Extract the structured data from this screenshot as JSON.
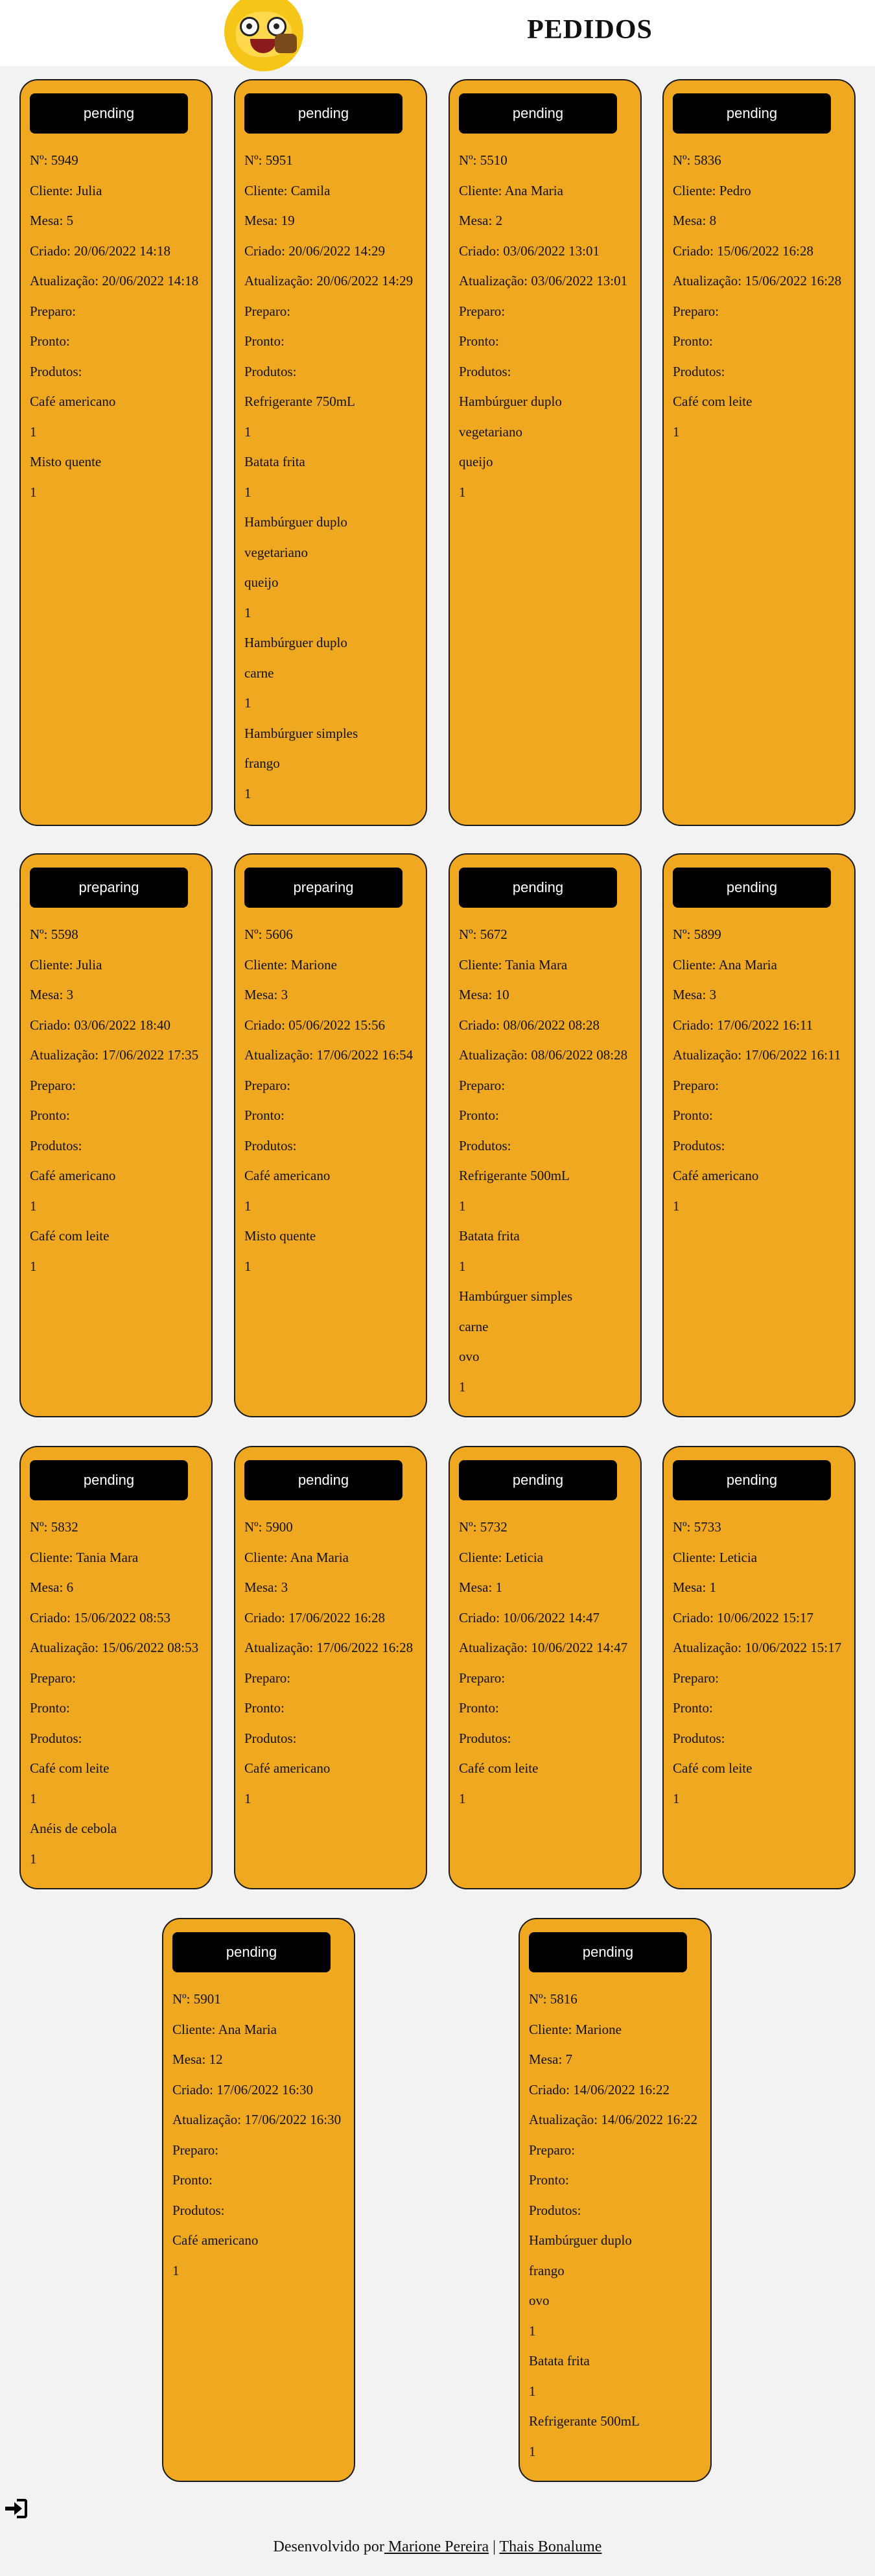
{
  "header": {
    "title": "PEDIDOS",
    "logo": "character-eating-burger-logo"
  },
  "labels": {
    "number": "Nº: ",
    "client": "Cliente: ",
    "table": "Mesa: ",
    "created": "Criado: ",
    "updated": "Atualização: ",
    "preparing": "Preparo:",
    "ready": "Pronto:",
    "products": "Produtos:"
  },
  "orders": [
    {
      "status": "pending",
      "number": "5949",
      "client": "Julia",
      "table": "5",
      "created": "20/06/2022 14:18",
      "updated": "20/06/2022 14:18",
      "products": [
        {
          "name": [
            "Café americano"
          ],
          "qty": "1"
        },
        {
          "name": [
            "Misto quente"
          ],
          "qty": "1"
        }
      ]
    },
    {
      "status": "pending",
      "number": "5951",
      "client": "Camila",
      "table": "19",
      "created": "20/06/2022 14:29",
      "updated": "20/06/2022 14:29",
      "products": [
        {
          "name": [
            "Refrigerante 750mL"
          ],
          "qty": "1"
        },
        {
          "name": [
            "Batata frita"
          ],
          "qty": "1"
        },
        {
          "name": [
            "Hambúrguer duplo",
            "vegetariano",
            "queijo"
          ],
          "qty": "1"
        },
        {
          "name": [
            "Hambúrguer duplo",
            "carne"
          ],
          "qty": "1"
        },
        {
          "name": [
            "Hambúrguer simples",
            "frango"
          ],
          "qty": "1"
        }
      ]
    },
    {
      "status": "pending",
      "number": "5510",
      "client": "Ana Maria",
      "table": "2",
      "created": "03/06/2022 13:01",
      "updated": "03/06/2022 13:01",
      "products": [
        {
          "name": [
            "Hambúrguer duplo",
            "vegetariano",
            "queijo"
          ],
          "qty": "1"
        }
      ]
    },
    {
      "status": "pending",
      "number": "5836",
      "client": "Pedro",
      "table": "8",
      "created": "15/06/2022 16:28",
      "updated": "15/06/2022 16:28",
      "products": [
        {
          "name": [
            "Café com leite"
          ],
          "qty": "1"
        }
      ]
    },
    {
      "status": "preparing",
      "number": "5598",
      "client": "Julia",
      "table": "3",
      "created": "03/06/2022 18:40",
      "updated": "17/06/2022 17:35",
      "products": [
        {
          "name": [
            "Café americano"
          ],
          "qty": "1"
        },
        {
          "name": [
            "Café com leite"
          ],
          "qty": "1"
        }
      ]
    },
    {
      "status": "preparing",
      "number": "5606",
      "client": "Marione",
      "table": "3",
      "created": "05/06/2022 15:56",
      "updated": "17/06/2022 16:54",
      "products": [
        {
          "name": [
            "Café americano"
          ],
          "qty": "1"
        },
        {
          "name": [
            "Misto quente"
          ],
          "qty": "1"
        }
      ]
    },
    {
      "status": "pending",
      "number": "5672",
      "client": "Tania Mara",
      "table": "10",
      "created": "08/06/2022 08:28",
      "updated": "08/06/2022 08:28",
      "products": [
        {
          "name": [
            "Refrigerante 500mL"
          ],
          "qty": "1"
        },
        {
          "name": [
            "Batata frita"
          ],
          "qty": "1"
        },
        {
          "name": [
            "Hambúrguer simples",
            "carne",
            "ovo"
          ],
          "qty": "1"
        }
      ]
    },
    {
      "status": "pending",
      "number": "5899",
      "client": "Ana Maria",
      "table": "3",
      "created": "17/06/2022 16:11",
      "updated": "17/06/2022 16:11",
      "products": [
        {
          "name": [
            "Café americano"
          ],
          "qty": "1"
        }
      ]
    },
    {
      "status": "pending",
      "number": "5832",
      "client": "Tania Mara",
      "table": "6",
      "created": "15/06/2022 08:53",
      "updated": "15/06/2022 08:53",
      "products": [
        {
          "name": [
            "Café com leite"
          ],
          "qty": "1"
        },
        {
          "name": [
            "Anéis de cebola"
          ],
          "qty": "1"
        }
      ]
    },
    {
      "status": "pending",
      "number": "5900",
      "client": "Ana Maria",
      "table": "3",
      "created": "17/06/2022 16:28",
      "updated": "17/06/2022 16:28",
      "products": [
        {
          "name": [
            "Café americano"
          ],
          "qty": "1"
        }
      ]
    },
    {
      "status": "pending",
      "number": "5732",
      "client": "Leticia",
      "table": "1",
      "created": "10/06/2022 14:47",
      "updated": "10/06/2022 14:47",
      "products": [
        {
          "name": [
            "Café com leite"
          ],
          "qty": "1"
        }
      ]
    },
    {
      "status": "pending",
      "number": "5733",
      "client": "Leticia",
      "table": "1",
      "created": "10/06/2022 15:17",
      "updated": "10/06/2022 15:17",
      "products": [
        {
          "name": [
            "Café com leite"
          ],
          "qty": "1"
        }
      ]
    },
    {
      "status": "pending",
      "number": "5901",
      "client": "Ana Maria",
      "table": "12",
      "created": "17/06/2022 16:30",
      "updated": "17/06/2022 16:30",
      "products": [
        {
          "name": [
            "Café americano"
          ],
          "qty": "1"
        }
      ]
    },
    {
      "status": "pending",
      "number": "5816",
      "client": "Marione",
      "table": "7",
      "created": "14/06/2022 16:22",
      "updated": "14/06/2022 16:22",
      "products": [
        {
          "name": [
            "Hambúrguer duplo",
            "frango",
            "ovo"
          ],
          "qty": "1"
        },
        {
          "name": [
            "Batata frita"
          ],
          "qty": "1"
        },
        {
          "name": [
            "Refrigerante 500mL"
          ],
          "qty": "1"
        }
      ]
    }
  ],
  "login_icon": "sign-in-icon",
  "footer": {
    "prefix": "Desenvolvido por",
    "author1": " Marione Pereira",
    "separator": " | ",
    "author2": "Thais Bonalume"
  }
}
